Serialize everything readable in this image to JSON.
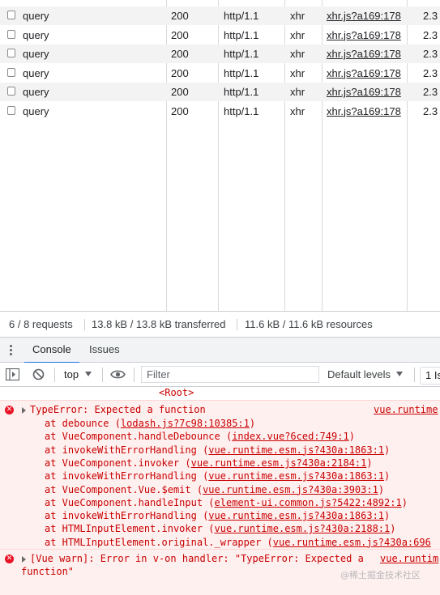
{
  "network": {
    "rows": [
      {
        "name": "query",
        "status": "200",
        "protocol": "http/1.1",
        "type": "xhr",
        "initiator": "xhr.js?a169:178",
        "size": "2.3"
      },
      {
        "name": "query",
        "status": "200",
        "protocol": "http/1.1",
        "type": "xhr",
        "initiator": "xhr.js?a169:178",
        "size": "2.3"
      },
      {
        "name": "query",
        "status": "200",
        "protocol": "http/1.1",
        "type": "xhr",
        "initiator": "xhr.js?a169:178",
        "size": "2.3"
      },
      {
        "name": "query",
        "status": "200",
        "protocol": "http/1.1",
        "type": "xhr",
        "initiator": "xhr.js?a169:178",
        "size": "2.3"
      },
      {
        "name": "query",
        "status": "200",
        "protocol": "http/1.1",
        "type": "xhr",
        "initiator": "xhr.js?a169:178",
        "size": "2.3"
      },
      {
        "name": "query",
        "status": "200",
        "protocol": "http/1.1",
        "type": "xhr",
        "initiator": "xhr.js?a169:178",
        "size": "2.3"
      }
    ]
  },
  "summary": {
    "requests": "6 / 8 requests",
    "transferred": "13.8 kB / 13.8 kB transferred",
    "resources": "11.6 kB / 11.6 kB resources"
  },
  "drawer": {
    "tabs": [
      {
        "label": "Console",
        "active": true
      },
      {
        "label": "Issues",
        "active": false
      }
    ]
  },
  "toolbar": {
    "context": "top",
    "filter_placeholder": "Filter",
    "levels": "Default levels",
    "issues": "1 Is"
  },
  "console": {
    "root_label": "<Root>",
    "error1": {
      "message": "TypeError: Expected a function",
      "source": "vue.runtime",
      "stack": [
        {
          "text": "at debounce (",
          "link": "lodash.js?7c98:10385:1",
          "end": ")"
        },
        {
          "text": "at VueComponent.handleDebounce (",
          "link": "index.vue?6ced:749:1",
          "end": ")"
        },
        {
          "text": "at invokeWithErrorHandling (",
          "link": "vue.runtime.esm.js?430a:1863:1",
          "end": ")"
        },
        {
          "text": "at VueComponent.invoker (",
          "link": "vue.runtime.esm.js?430a:2184:1",
          "end": ")"
        },
        {
          "text": "at invokeWithErrorHandling (",
          "link": "vue.runtime.esm.js?430a:1863:1",
          "end": ")"
        },
        {
          "text": "at VueComponent.Vue.$emit (",
          "link": "vue.runtime.esm.js?430a:3903:1",
          "end": ")"
        },
        {
          "text": "at VueComponent.handleInput (",
          "link": "element-ui.common.js?5422:4892:1",
          "end": ")"
        },
        {
          "text": "at invokeWithErrorHandling (",
          "link": "vue.runtime.esm.js?430a:1863:1",
          "end": ")"
        },
        {
          "text": "at HTMLInputElement.invoker (",
          "link": "vue.runtime.esm.js?430a:2188:1",
          "end": ")"
        },
        {
          "text": "at HTMLInputElement.original._wrapper (",
          "link": "vue.runtime.esm.js?430a:696",
          "end": ""
        }
      ]
    },
    "error2": {
      "message_line1": "[Vue warn]: Error in v-on handler: \"TypeError: Expected a",
      "message_line2": "function\"",
      "source": "vue.runtim"
    },
    "watermark": "@稀土掘金技术社区"
  },
  "colors": {
    "error_text": "#c80000",
    "error_bg": "#fff0f0",
    "active_tab": "#1a73e8"
  }
}
